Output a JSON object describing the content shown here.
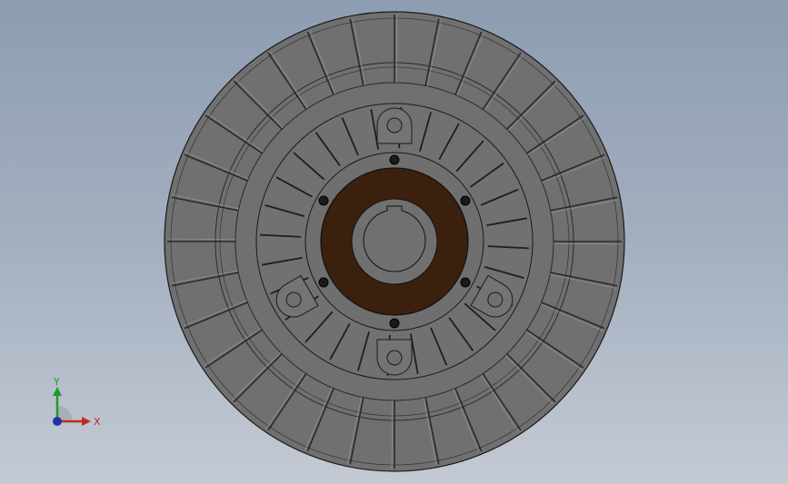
{
  "viewport": {
    "background_top": "#8d9db1",
    "background_bottom": "#c4cad4"
  },
  "model": {
    "name": "",
    "colors": {
      "body": "#6f6f6f",
      "edge": "#1a1a1a",
      "hub": "#3a1f0e",
      "bore": "#6f6f6f"
    }
  },
  "triad": {
    "x_label": "X",
    "y_label": "Y",
    "x_color": "#c22a22",
    "y_color": "#1f9a2a",
    "z_color": "#2233aa",
    "icons": [
      "axis-triad-icon"
    ]
  }
}
